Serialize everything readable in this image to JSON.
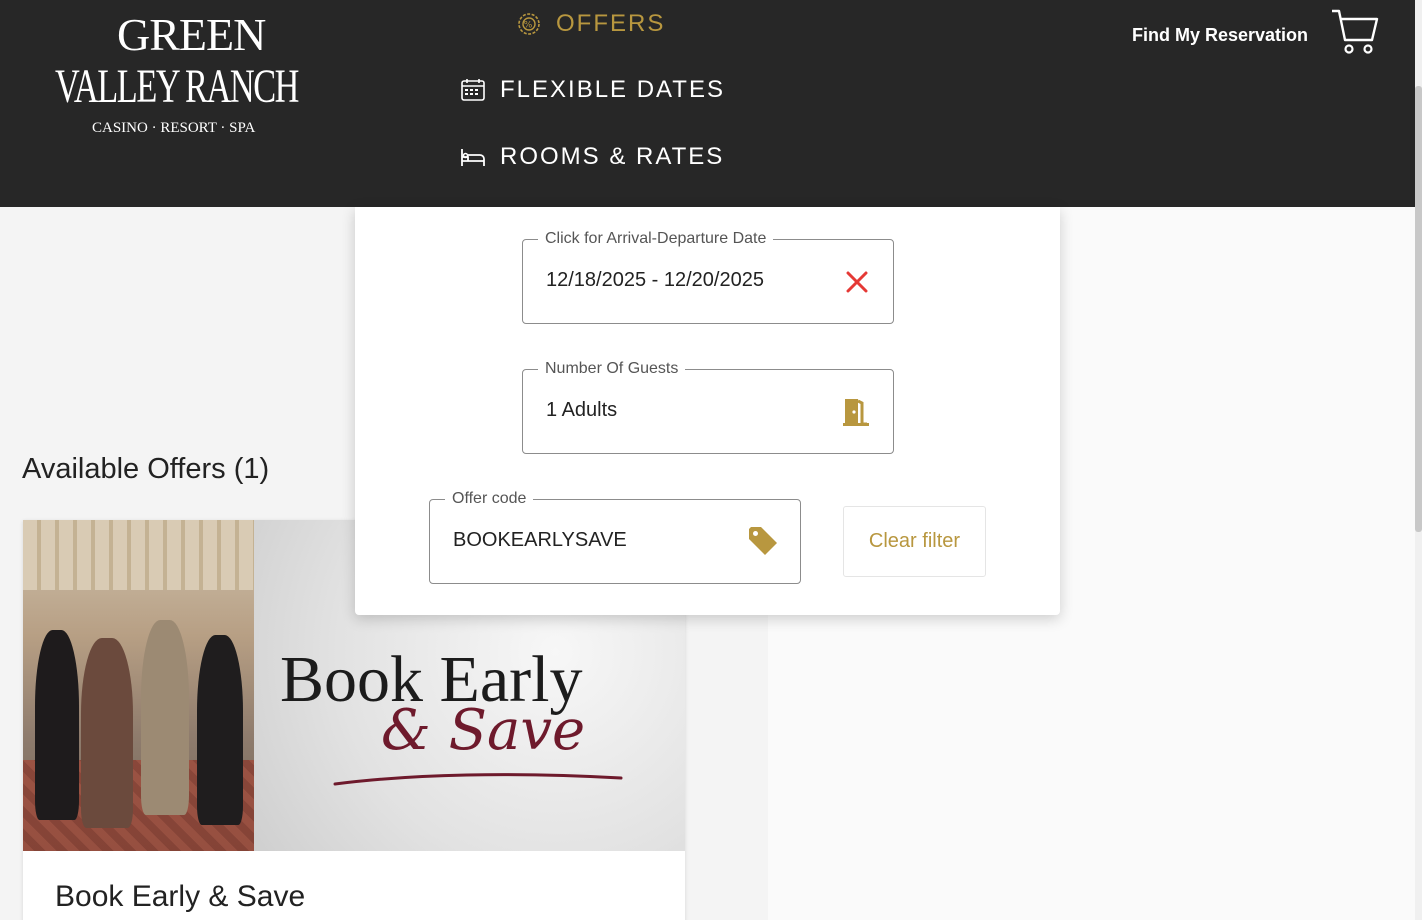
{
  "brand": {
    "line1": "GREEN",
    "line2": "VALLEY RANCH",
    "tagline": "CASINO · RESORT · SPA"
  },
  "nav": {
    "offers": "OFFERS",
    "flexible_dates": "FLEXIBLE DATES",
    "rooms_rates": "ROOMS & RATES"
  },
  "header": {
    "find_reservation": "Find My Reservation",
    "cart_icon": "cart-icon"
  },
  "search": {
    "dates": {
      "label": "Click for Arrival-Departure Date",
      "value": "12/18/2025 - 12/20/2025",
      "icon": "clear-x-icon"
    },
    "guests": {
      "label": "Number Of Guests",
      "value": "1 Adults",
      "icon": "door-icon"
    },
    "offer_code": {
      "label": "Offer code",
      "value": "BOOKEARLYSAVE",
      "icon": "tag-icon"
    },
    "clear_filter": "Clear filter"
  },
  "offers": {
    "heading": "Available Offers (1)",
    "items": [
      {
        "title": "Book Early & Save",
        "image_title": "Book Early",
        "image_subtitle": "& Save"
      }
    ]
  },
  "colors": {
    "header_bg": "#272727",
    "accent_gold": "#b8973f",
    "clear_red": "#e53935",
    "promo_burgundy": "#6e1a2c"
  }
}
